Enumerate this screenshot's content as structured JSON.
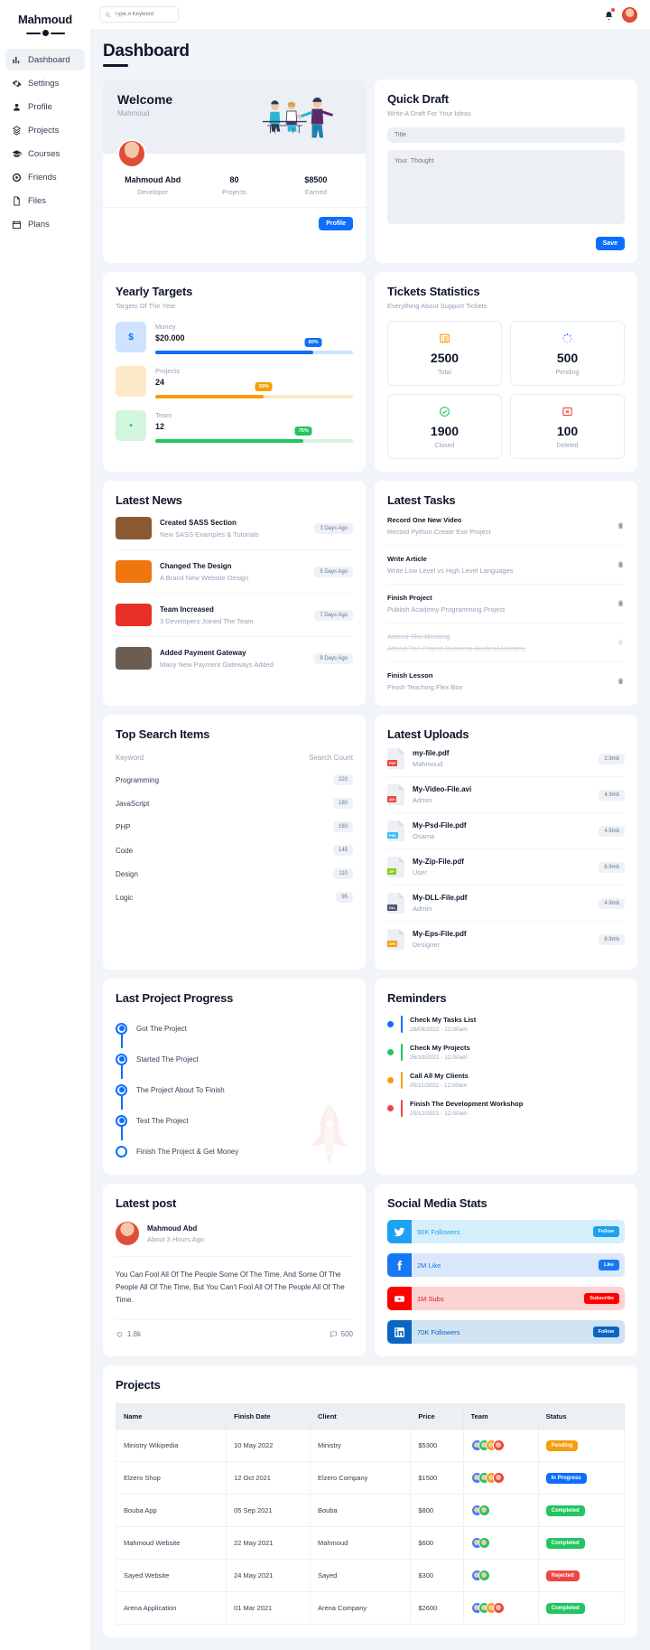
{
  "sidebar": {
    "brand": "Mahmoud",
    "items": [
      {
        "label": "Dashboard",
        "icon": "dashboard-icon",
        "active": true
      },
      {
        "label": "Settings",
        "icon": "gear-icon",
        "active": false
      },
      {
        "label": "Profile",
        "icon": "user-icon",
        "active": false
      },
      {
        "label": "Projects",
        "icon": "projects-icon",
        "active": false
      },
      {
        "label": "Courses",
        "icon": "graduation-cap-icon",
        "active": false
      },
      {
        "label": "Friends",
        "icon": "friends-icon",
        "active": false
      },
      {
        "label": "Files",
        "icon": "file-icon",
        "active": false
      },
      {
        "label": "Plans",
        "icon": "calendar-icon",
        "active": false
      }
    ]
  },
  "topbar": {
    "search_placeholder": "Type A Keyword",
    "search_value": "",
    "notification_icon": "bell-icon",
    "avatar": "user-avatar"
  },
  "page": {
    "title": "Dashboard"
  },
  "welcome": {
    "title": "Welcome",
    "subtitle": "Mahmoud",
    "stats": [
      {
        "value": "Mahmoud Abd",
        "label": "Developer"
      },
      {
        "value": "80",
        "label": "Projects"
      },
      {
        "value": "$8500",
        "label": "Earned"
      }
    ],
    "button": "Profile"
  },
  "quick_draft": {
    "title": "Quick Draft",
    "subtitle": "Write A Draft For Your Ideas",
    "title_placeholder": "Title",
    "title_value": "",
    "body_placeholder": "Your  Thought",
    "body_value": "",
    "save_label": "Save"
  },
  "yearly_targets": {
    "title": "Yearly Targets",
    "subtitle": "Targets Of The Year",
    "rows": [
      {
        "label": "Money",
        "value": "$20.000",
        "percent": "80%",
        "pct": 80,
        "color": "#0d6efd",
        "bg": "#cfe2ff",
        "icon": "dollar-icon",
        "glyph": "$"
      },
      {
        "label": "Projects",
        "value": "24",
        "percent": "55%",
        "pct": 55,
        "color": "#f59e0b",
        "bg": "#fde8c8",
        "icon": "code-icon",
        "glyph": "</>"
      },
      {
        "label": "Team",
        "value": "12",
        "percent": "75%",
        "pct": 75,
        "color": "#22c55e",
        "bg": "#d3f5df",
        "icon": "user-icon",
        "glyph": "•"
      }
    ]
  },
  "tickets": {
    "title": "Tickets Statistics",
    "subtitle": "Everything About Support Tickets",
    "boxes": [
      {
        "value": "2500",
        "label": "Total",
        "icon": "list-icon",
        "color": "#f59e0b"
      },
      {
        "value": "500",
        "label": "Pending",
        "icon": "spinner-icon",
        "color": "#0d6efd"
      },
      {
        "value": "1900",
        "label": "Closed",
        "icon": "check-circle-icon",
        "color": "#22c55e"
      },
      {
        "value": "100",
        "label": "Deleted",
        "icon": "delete-icon",
        "color": "#ef4444"
      }
    ]
  },
  "latest_news": {
    "title": "Latest News",
    "items": [
      {
        "title": "Created SASS Section",
        "subtitle": "New SASS Examples & Tutorials",
        "time": "3 Days Ago",
        "thumb": "#8a5a34"
      },
      {
        "title": "Changed The Design",
        "subtitle": "A Brand New Website Design",
        "time": "5 Days Ago",
        "thumb": "#f0760f"
      },
      {
        "title": "Team Increased",
        "subtitle": "3 Developers Joined The Team",
        "time": "7 Days Ago",
        "thumb": "#e8302a"
      },
      {
        "title": "Added Payment Gateway",
        "subtitle": "Many New Payment Gateways Added",
        "time": "9 Days Ago",
        "thumb": "#6b5d52"
      }
    ]
  },
  "latest_tasks": {
    "title": "Latest Tasks",
    "items": [
      {
        "title": "Record One New Video",
        "subtitle": "Record Python Create Exe Project",
        "done": false
      },
      {
        "title": "Write Article",
        "subtitle": "Write Low Level vs High Level Languages",
        "done": false
      },
      {
        "title": "Finish Project",
        "subtitle": "Publish Academy Programming Project",
        "done": false
      },
      {
        "title": "Attend The Meeting",
        "subtitle": "Attend The Project Business Analysis Meeting",
        "done": true
      },
      {
        "title": "Finish Lesson",
        "subtitle": "Finish Teaching Flex Box",
        "done": false
      }
    ]
  },
  "top_search": {
    "title": "Top Search Items",
    "col_keyword": "Keyword",
    "col_count": "Search Count",
    "rows": [
      {
        "keyword": "Programming",
        "count": "220"
      },
      {
        "keyword": "JavaScript",
        "count": "180"
      },
      {
        "keyword": "PHP",
        "count": "160"
      },
      {
        "keyword": "Code",
        "count": "145"
      },
      {
        "keyword": "Design",
        "count": "110"
      },
      {
        "keyword": "Logic",
        "count": "95"
      }
    ]
  },
  "latest_uploads": {
    "title": "Latest Uploads",
    "items": [
      {
        "name": "my-file.pdf",
        "user": "Mahmoud",
        "size": "2.9mb",
        "tag": "PDF",
        "tag_color": "#ef4444"
      },
      {
        "name": "My-Video-File.avi",
        "user": "Admin",
        "size": "4.9mb",
        "tag": "AVI",
        "tag_color": "#ef4444"
      },
      {
        "name": "My-Psd-File.pdf",
        "user": "Osama",
        "size": "4.5mb",
        "tag": "PSD",
        "tag_color": "#38bdf8"
      },
      {
        "name": "My-Zip-File.pdf",
        "user": "User",
        "size": "8.9mb",
        "tag": "ZIP",
        "tag_color": "#84cc16"
      },
      {
        "name": "My-DLL-File.pdf",
        "user": "Admin",
        "size": "4.9mb",
        "tag": "DLL",
        "tag_color": "#475569"
      },
      {
        "name": "My-Eps-File.pdf",
        "user": "Designer",
        "size": "8.9mb",
        "tag": "EPS",
        "tag_color": "#f59e0b"
      }
    ]
  },
  "project_progress": {
    "title": "Last Project Progress",
    "steps": [
      {
        "label": "Got The Project",
        "filled": true
      },
      {
        "label": "Started The Project",
        "filled": true
      },
      {
        "label": "The Project About To Finish",
        "filled": true
      },
      {
        "label": "Test The Project",
        "filled": true
      },
      {
        "label": "Finish The Project & Get Money",
        "filled": false
      }
    ]
  },
  "reminders": {
    "title": "Reminders",
    "items": [
      {
        "title": "Check My Tasks List",
        "date": "28/09/2022 - 12:00am",
        "color": "#0d6efd"
      },
      {
        "title": "Check My Projects",
        "date": "26/10/2022 - 12:00am",
        "color": "#22c55e"
      },
      {
        "title": "Call All My Clients",
        "date": "05/11/2022 - 12:00am",
        "color": "#f59e0b"
      },
      {
        "title": "Finish The Development Workshop",
        "date": "20/12/2022 - 12:00am",
        "color": "#ef4444"
      }
    ]
  },
  "latest_post": {
    "title": "Latest post",
    "author": "Mahmoud Abd",
    "time": "About 3 Hours Ago",
    "body": "You Can Fool All Of The People Some Of The Time, And Some Of The People All Of The Time, But You Can't Fool All Of The People All Of The Time.",
    "likes": "1.8k",
    "comments": "500"
  },
  "social": {
    "title": "Social Media Stats",
    "rows": [
      {
        "network": "twitter",
        "text": "90K Followers",
        "button": "Follow",
        "icon_bg": "#1da1f2",
        "row_bg": "#d5effd",
        "text_color": "#1da1f2",
        "btn_bg": "#1da1f2"
      },
      {
        "network": "facebook",
        "text": "2M Like",
        "button": "Like",
        "icon_bg": "#1877f2",
        "row_bg": "#dbe7fb",
        "text_color": "#1877f2",
        "btn_bg": "#1877f2"
      },
      {
        "network": "youtube",
        "text": "1M Subs",
        "button": "Subscribe",
        "icon_bg": "#ff0000",
        "row_bg": "#fcd2d2",
        "text_color": "#e01b1b",
        "btn_bg": "#ff0000"
      },
      {
        "network": "linkedin",
        "text": "70K Followers",
        "button": "Follow",
        "icon_bg": "#0a66c2",
        "row_bg": "#cfe3f3",
        "text_color": "#0a66c2",
        "btn_bg": "#0a66c2"
      }
    ]
  },
  "projects_table": {
    "title": "Projects",
    "columns": [
      "Name",
      "Finish Date",
      "Client",
      "Price",
      "Team",
      "Status"
    ],
    "rows": [
      {
        "name": "Ministry Wikipedia",
        "date": "10 May 2022",
        "client": "Ministry",
        "price": "$5300",
        "team": 4,
        "status": "Pending",
        "status_color": "#f59e0b"
      },
      {
        "name": "Elzero Shop",
        "date": "12 Oct 2021",
        "client": "Elzero Company",
        "price": "$1500",
        "team": 4,
        "status": "In Progress",
        "status_color": "#0d6efd"
      },
      {
        "name": "Bouba App",
        "date": "05 Sep 2021",
        "client": "Bouba",
        "price": "$800",
        "team": 2,
        "status": "Completed",
        "status_color": "#22c55e"
      },
      {
        "name": "Mahmoud Website",
        "date": "22 May 2021",
        "client": "Mahmoud",
        "price": "$600",
        "team": 2,
        "status": "Completed",
        "status_color": "#22c55e"
      },
      {
        "name": "Sayed Website",
        "date": "24 May 2021",
        "client": "Sayed",
        "price": "$300",
        "team": 2,
        "status": "Rejected",
        "status_color": "#ef4444"
      },
      {
        "name": "Arena Application",
        "date": "01 Mar 2021",
        "client": "Arena Company",
        "price": "$2600",
        "team": 4,
        "status": "Completed",
        "status_color": "#22c55e"
      }
    ]
  }
}
